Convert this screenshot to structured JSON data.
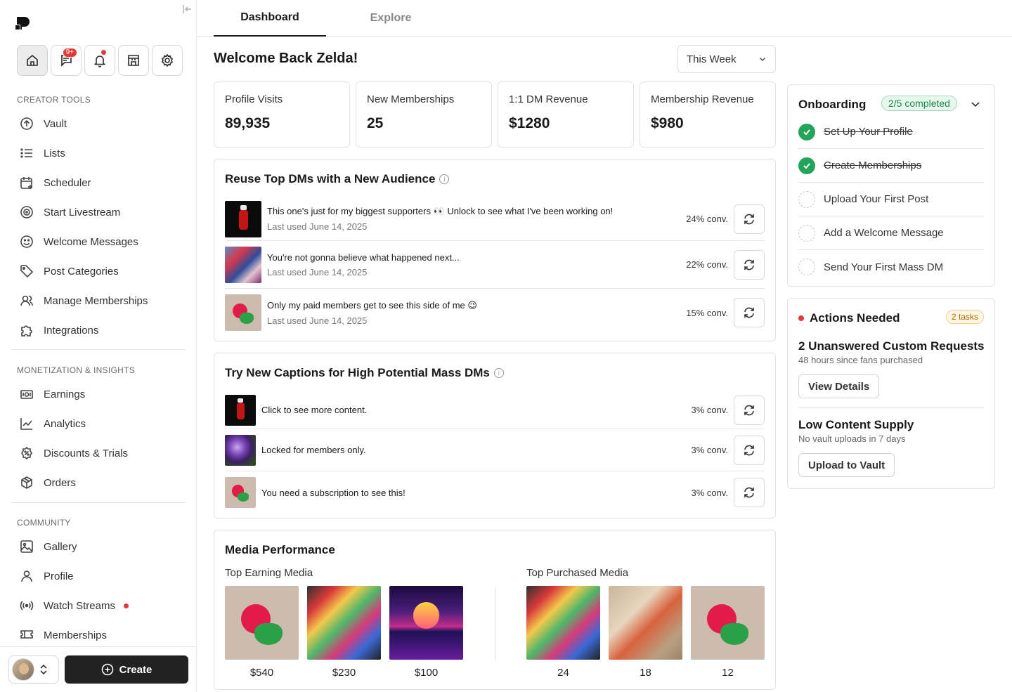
{
  "tabs": [
    {
      "label": "Dashboard"
    },
    {
      "label": "Explore"
    }
  ],
  "sidebar": {
    "notif_badge": "9+",
    "sections": [
      {
        "title": "CREATOR TOOLS",
        "items": [
          {
            "label": "Vault",
            "icon": "upload-circle-icon"
          },
          {
            "label": "Lists",
            "icon": "list-icon"
          },
          {
            "label": "Scheduler",
            "icon": "calendar-plus-icon"
          },
          {
            "label": "Start Livestream",
            "icon": "live-icon"
          },
          {
            "label": "Welcome Messages",
            "icon": "smile-icon"
          },
          {
            "label": "Post Categories",
            "icon": "tag-icon"
          },
          {
            "label": "Manage Memberships",
            "icon": "users-icon"
          },
          {
            "label": "Integrations",
            "icon": "puzzle-icon"
          }
        ]
      },
      {
        "title": "MONETIZATION & INSIGHTS",
        "items": [
          {
            "label": "Earnings",
            "icon": "money-icon"
          },
          {
            "label": "Analytics",
            "icon": "chart-line-icon"
          },
          {
            "label": "Discounts & Trials",
            "icon": "discount-icon"
          },
          {
            "label": "Orders",
            "icon": "box-icon"
          }
        ]
      },
      {
        "title": "COMMUNITY",
        "items": [
          {
            "label": "Gallery",
            "icon": "image-icon"
          },
          {
            "label": "Profile",
            "icon": "user-icon"
          },
          {
            "label": "Watch Streams",
            "icon": "broadcast-icon"
          },
          {
            "label": "Memberships",
            "icon": "memberships-icon"
          }
        ]
      }
    ],
    "create_label": "Create"
  },
  "header": {
    "welcome": "Welcome Back Zelda!",
    "period": "This Week"
  },
  "stats": [
    {
      "label": "Profile Visits",
      "value": "89,935"
    },
    {
      "label": "New Memberships",
      "value": "25"
    },
    {
      "label": "1:1 DM Revenue",
      "value": "$1280"
    },
    {
      "label": "Membership Revenue",
      "value": "$980"
    }
  ],
  "reuse": {
    "title": "Reuse Top DMs with a New Audience",
    "rows": [
      {
        "message": "This one's just for my biggest supporters 👀 Unlock to see what I've been working on!",
        "last_used": "Last used June 14, 2025",
        "conv": "24% conv."
      },
      {
        "message": "You're not gonna believe what happened next...",
        "last_used": "Last used June 14, 2025",
        "conv": "22% conv."
      },
      {
        "message": "Only my paid members get to see this side of me 😉",
        "last_used": "Last used June 14, 2025",
        "conv": "15% conv."
      }
    ]
  },
  "captions": {
    "title": "Try New Captions for High Potential Mass DMs",
    "rows": [
      {
        "message": "Click to see more content.",
        "conv": "3% conv."
      },
      {
        "message": "Locked for members only.",
        "conv": "3% conv."
      },
      {
        "message": "You need a subscription to see this!",
        "conv": "3% conv."
      }
    ]
  },
  "media": {
    "title": "Media Performance",
    "earning_title": "Top Earning Media",
    "earning": [
      {
        "value": "$540"
      },
      {
        "value": "$230"
      },
      {
        "value": "$100"
      }
    ],
    "purchased_title": "Top Purchased Media",
    "purchased": [
      {
        "value": "24"
      },
      {
        "value": "18"
      },
      {
        "value": "12"
      }
    ]
  },
  "onboarding": {
    "title": "Onboarding",
    "progress": "2/5 completed",
    "tasks": [
      {
        "label": "Set Up Your Profile",
        "done": true
      },
      {
        "label": "Create Memberships",
        "done": true
      },
      {
        "label": "Upload Your First Post",
        "done": false
      },
      {
        "label": "Add a Welcome Message",
        "done": false
      },
      {
        "label": "Send Your First Mass DM",
        "done": false
      }
    ]
  },
  "actions": {
    "title": "Actions Needed",
    "count": "2 tasks",
    "items": [
      {
        "heading": "2 Unanswered Custom Requests",
        "sub": "48 hours since fans purchased",
        "button": "View Details"
      },
      {
        "heading": "Low Content Supply",
        "sub": "No vault uploads in 7 days",
        "button": "Upload to Vault"
      }
    ]
  },
  "colors": {
    "accent": "#22a55a",
    "alert": "#e53935",
    "dark": "#222222"
  }
}
